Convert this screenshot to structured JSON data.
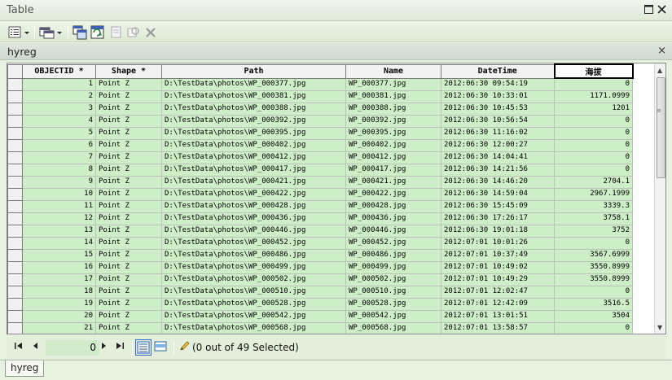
{
  "window": {
    "title": "Table",
    "buttons": {
      "restore_icon": "restore-icon",
      "close_icon": "close-icon"
    }
  },
  "toolbar": {
    "items": [
      "table-options-dropdown",
      "related-tables-dropdown",
      "select-by-attributes",
      "switch-selection",
      "clear-selection",
      "zoom-to-selected",
      "delete-selected"
    ]
  },
  "tab": {
    "title": "hyreg",
    "close": "×"
  },
  "table": {
    "columns": [
      "OBJECTID *",
      "Shape *",
      "Path",
      "Name",
      "DateTime",
      "海拔"
    ],
    "rows": [
      [
        "1",
        "Point Z",
        "D:\\TestData\\photos\\WP_000377.jpg",
        "WP_000377.jpg",
        "2012:06:30 09:54:19",
        "0"
      ],
      [
        "2",
        "Point Z",
        "D:\\TestData\\photos\\WP_000381.jpg",
        "WP_000381.jpg",
        "2012:06:30 10:33:01",
        "1171.0999"
      ],
      [
        "3",
        "Point Z",
        "D:\\TestData\\photos\\WP_000388.jpg",
        "WP_000388.jpg",
        "2012:06:30 10:45:53",
        "1201"
      ],
      [
        "4",
        "Point Z",
        "D:\\TestData\\photos\\WP_000392.jpg",
        "WP_000392.jpg",
        "2012:06:30 10:56:54",
        "0"
      ],
      [
        "5",
        "Point Z",
        "D:\\TestData\\photos\\WP_000395.jpg",
        "WP_000395.jpg",
        "2012:06:30 11:16:02",
        "0"
      ],
      [
        "6",
        "Point Z",
        "D:\\TestData\\photos\\WP_000402.jpg",
        "WP_000402.jpg",
        "2012:06:30 12:00:27",
        "0"
      ],
      [
        "7",
        "Point Z",
        "D:\\TestData\\photos\\WP_000412.jpg",
        "WP_000412.jpg",
        "2012:06:30 14:04:41",
        "0"
      ],
      [
        "8",
        "Point Z",
        "D:\\TestData\\photos\\WP_000417.jpg",
        "WP_000417.jpg",
        "2012:06:30 14:21:56",
        "0"
      ],
      [
        "9",
        "Point Z",
        "D:\\TestData\\photos\\WP_000421.jpg",
        "WP_000421.jpg",
        "2012:06:30 14:46:20",
        "2704.1"
      ],
      [
        "10",
        "Point Z",
        "D:\\TestData\\photos\\WP_000422.jpg",
        "WP_000422.jpg",
        "2012:06:30 14:59:04",
        "2967.1999"
      ],
      [
        "11",
        "Point Z",
        "D:\\TestData\\photos\\WP_000428.jpg",
        "WP_000428.jpg",
        "2012:06:30 15:45:09",
        "3339.3"
      ],
      [
        "12",
        "Point Z",
        "D:\\TestData\\photos\\WP_000436.jpg",
        "WP_000436.jpg",
        "2012:06:30 17:26:17",
        "3758.1"
      ],
      [
        "13",
        "Point Z",
        "D:\\TestData\\photos\\WP_000446.jpg",
        "WP_000446.jpg",
        "2012:06:30 19:01:18",
        "3752"
      ],
      [
        "14",
        "Point Z",
        "D:\\TestData\\photos\\WP_000452.jpg",
        "WP_000452.jpg",
        "2012:07:01 10:01:26",
        "0"
      ],
      [
        "15",
        "Point Z",
        "D:\\TestData\\photos\\WP_000486.jpg",
        "WP_000486.jpg",
        "2012:07:01 10:37:49",
        "3567.6999"
      ],
      [
        "16",
        "Point Z",
        "D:\\TestData\\photos\\WP_000499.jpg",
        "WP_000499.jpg",
        "2012:07:01 10:49:02",
        "3550.8999"
      ],
      [
        "17",
        "Point Z",
        "D:\\TestData\\photos\\WP_000502.jpg",
        "WP_000502.jpg",
        "2012:07:01 10:49:29",
        "3550.8999"
      ],
      [
        "18",
        "Point Z",
        "D:\\TestData\\photos\\WP_000510.jpg",
        "WP_000510.jpg",
        "2012:07:01 12:02:47",
        "0"
      ],
      [
        "19",
        "Point Z",
        "D:\\TestData\\photos\\WP_000528.jpg",
        "WP_000528.jpg",
        "2012:07:01 12:42:09",
        "3516.5"
      ],
      [
        "20",
        "Point Z",
        "D:\\TestData\\photos\\WP_000542.jpg",
        "WP_000542.jpg",
        "2012:07:01 13:01:51",
        "3504"
      ],
      [
        "21",
        "Point Z",
        "D:\\TestData\\photos\\WP_000568.jpg",
        "WP_000568.jpg",
        "2012:07:01 13:58:57",
        "0"
      ]
    ]
  },
  "statusbar": {
    "current_record": "0",
    "selected_text": "(0 out of 49 Selected)"
  },
  "bottom_tab": {
    "label": "hyreg"
  },
  "colors": {
    "row_bg": "#cdeec6",
    "frame_bg": "#e8f2e0",
    "accent": "#3a6fb0"
  }
}
